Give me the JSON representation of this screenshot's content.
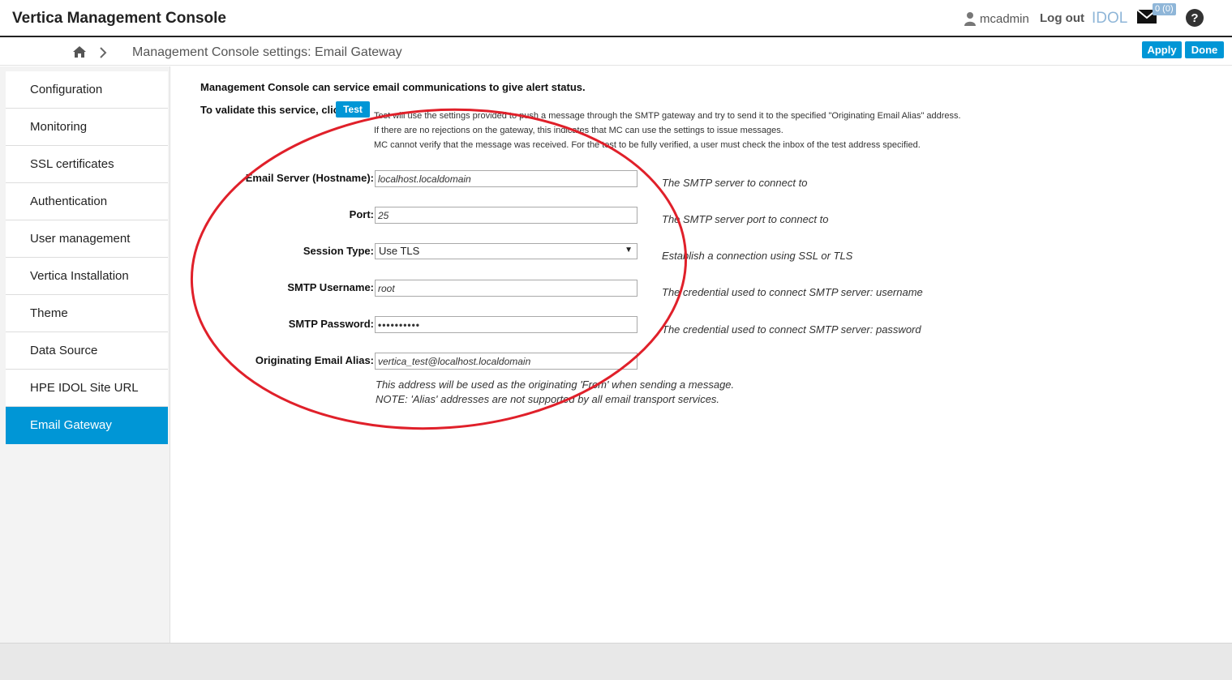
{
  "header": {
    "title": "Vertica Management Console",
    "username": "mcadmin",
    "logout": "Log out",
    "idol": "IDOL",
    "mail_badge": "0 (0)"
  },
  "subheader": {
    "page_title": "Management Console settings: Email Gateway",
    "apply": "Apply",
    "done": "Done"
  },
  "sidebar": {
    "items": [
      {
        "label": "Configuration"
      },
      {
        "label": "Monitoring"
      },
      {
        "label": "SSL certificates"
      },
      {
        "label": "Authentication"
      },
      {
        "label": "User management"
      },
      {
        "label": "Vertica Installation"
      },
      {
        "label": "Theme"
      },
      {
        "label": "Data Source"
      },
      {
        "label": "HPE IDOL Site URL"
      },
      {
        "label": "Email Gateway"
      }
    ],
    "active_index": 9
  },
  "content": {
    "intro": "Management Console can service email communications to give alert status.",
    "validate_label": "To validate this service, click",
    "test_button": "Test",
    "test_note": [
      "Test will use the settings provided to push a message through the SMTP gateway and try to send it to the specified \"Originating Email Alias\" address.",
      "If there are no rejections on the gateway, this indicates that MC can use the settings to issue messages.",
      "MC cannot verify that the message was received. For the test to be fully verified, a user must check the inbox of the test address specified."
    ],
    "fields": {
      "hostname": {
        "label": "Email Server (Hostname):",
        "value": "localhost.localdomain",
        "hint": "The SMTP server to connect to"
      },
      "port": {
        "label": "Port:",
        "value": "25",
        "hint": "The SMTP server port to connect to"
      },
      "session_type": {
        "label": "Session Type:",
        "value": "Use TLS",
        "hint": "Establish a connection using SSL or TLS"
      },
      "username": {
        "label": "SMTP Username:",
        "value": "root",
        "hint": "The credential used to connect SMTP server: username"
      },
      "password": {
        "label": "SMTP Password:",
        "value": "••••••••••",
        "hint": "The credential used to connect SMTP server: password"
      },
      "alias": {
        "label": "Originating Email Alias:",
        "value": "vertica_test@localhost.localdomain"
      }
    },
    "alias_note": [
      "This address will be used as the originating 'From' when sending a message.",
      "NOTE: 'Alias' addresses are not supported by all email transport services."
    ]
  },
  "colors": {
    "accent": "#0096d6",
    "idol": "#8fb6d8",
    "annotation": "#e0202a"
  }
}
